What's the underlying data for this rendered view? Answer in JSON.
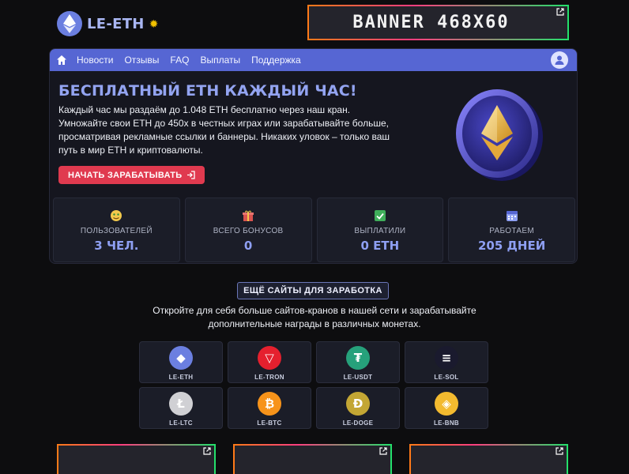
{
  "site": {
    "logo_text": "LE-ETH",
    "logo_icon": "eth-icon",
    "badge_icon": "sun-icon"
  },
  "banner_top": {
    "text": "BANNER 468X60",
    "icon": "external-link-icon"
  },
  "nav": {
    "home_icon": "home-icon",
    "items": [
      "Новости",
      "Отзывы",
      "FAQ",
      "Выплаты",
      "Поддержка"
    ],
    "user_icon": "user-icon"
  },
  "hero": {
    "title": "БЕСПЛАТНЫЙ ETH КАЖДЫЙ ЧАС!",
    "text": "Каждый час мы раздаём до 1.048 ETH бесплатно через наш кран. Умножайте свои ETH до 450x в честных играх или зарабатывайте больше, просматривая рекламные ссылки и баннеры. Никаких уловок – только ваш путь в мир ETH и криптовалюты.",
    "cta_label": "НАЧАТЬ ЗАРАБАТЫВАТЬ",
    "cta_icon": "login-icon",
    "image": "eth-coin-icon"
  },
  "stats": [
    {
      "icon": "money-face-icon",
      "label": "ПОЛЬЗОВАТЕЛЕЙ",
      "value": "3 ЧЕЛ."
    },
    {
      "icon": "gift-icon",
      "label": "ВСЕГО БОНУСОВ",
      "value": "0"
    },
    {
      "icon": "check-icon",
      "label": "ВЫПЛАТИЛИ",
      "value": "0 ETH"
    },
    {
      "icon": "calendar-icon",
      "label": "РАБОТАЕМ",
      "value": "205 ДНЕЙ"
    }
  ],
  "more_sites": {
    "title": "ЕЩЁ САЙТЫ ДЛЯ ЗАРАБОТКА",
    "desc": "Откройте для себя больше сайтов-кранов в нашей сети и зарабатывайте дополнительные награды в различных монетах.",
    "sites": [
      {
        "name": "LE-ETH",
        "color": "#6b7fe0",
        "symbol": "◆"
      },
      {
        "name": "LE-TRON",
        "color": "#e5202e",
        "symbol": "▽"
      },
      {
        "name": "LE-USDT",
        "color": "#26a17b",
        "symbol": "₮"
      },
      {
        "name": "LE-SOL",
        "color": "#1a1a2e",
        "symbol": "≡"
      },
      {
        "name": "LE-LTC",
        "color": "#d0d0d4",
        "symbol": "Ł"
      },
      {
        "name": "LE-BTC",
        "color": "#f7931a",
        "symbol": "₿"
      },
      {
        "name": "LE-DOGE",
        "color": "#c3a634",
        "symbol": "Ð"
      },
      {
        "name": "LE-BNB",
        "color": "#f3ba2f",
        "symbol": "◈"
      }
    ]
  },
  "colors": {
    "accent": "#5666d3",
    "cta": "#e03a4f",
    "value": "#8e9ff2",
    "background": "#0d0d0f"
  }
}
